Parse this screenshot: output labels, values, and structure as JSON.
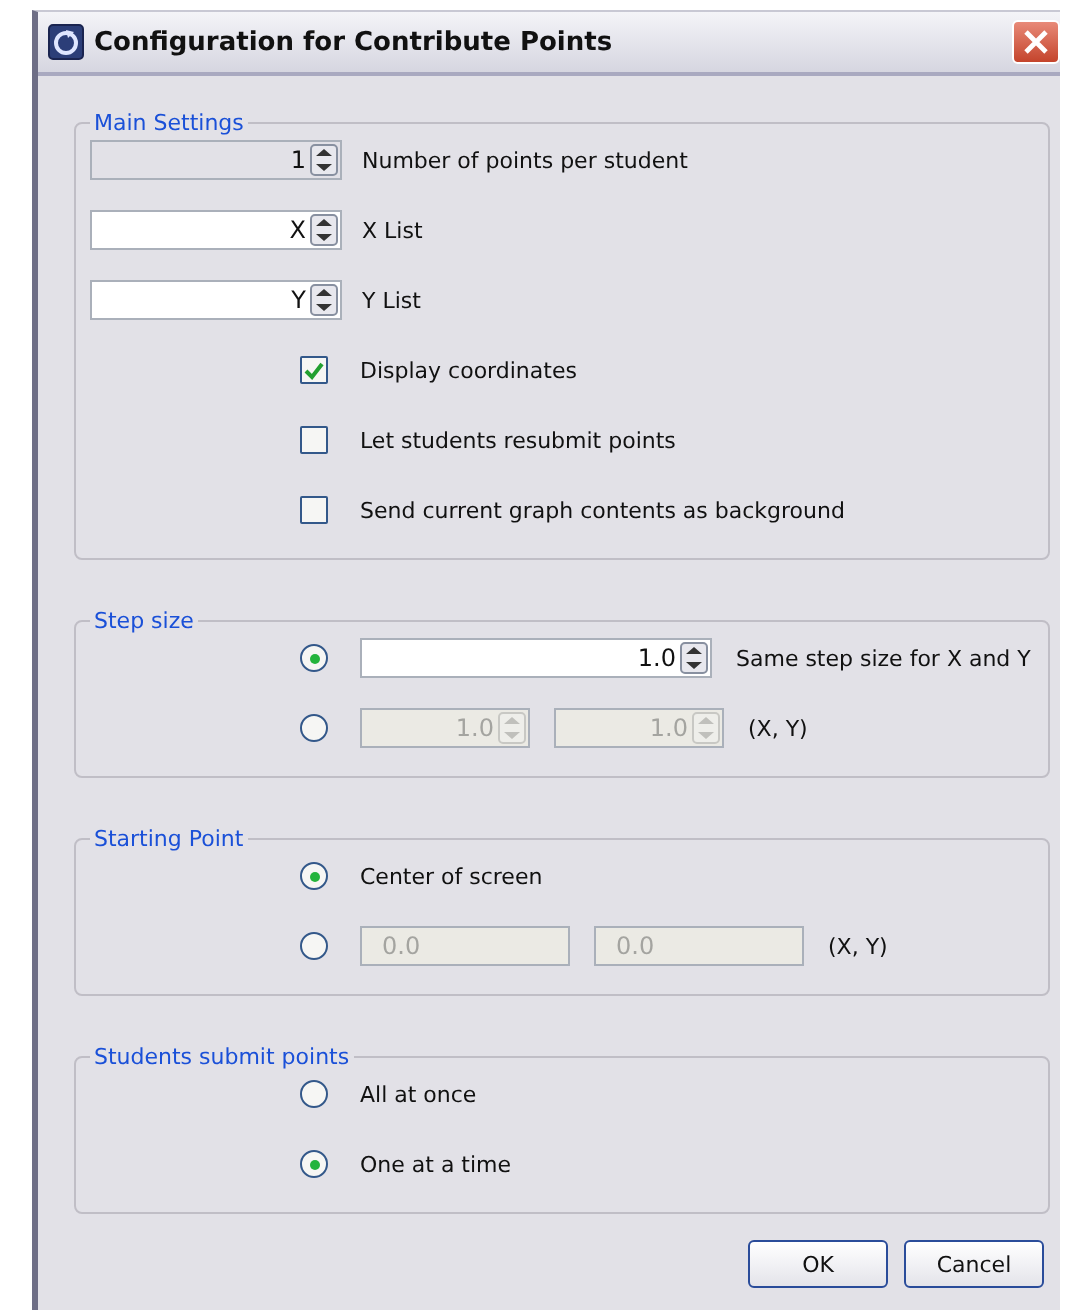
{
  "window": {
    "title": "Configuration for Contribute Points"
  },
  "sections": [
    {
      "title": "Main Settings",
      "rows": [
        {
          "kind": "spinner",
          "label": "Number of points per student",
          "field": {
            "value": "1",
            "editable": false,
            "disabled": false
          }
        },
        {
          "kind": "spinner",
          "label": "X List",
          "field": {
            "value": "X",
            "editable": true,
            "disabled": false
          }
        },
        {
          "kind": "spinner",
          "label": "Y List",
          "field": {
            "value": "Y",
            "editable": true,
            "disabled": false
          }
        },
        {
          "kind": "checkbox",
          "label": "Display coordinates",
          "checked": true
        },
        {
          "kind": "checkbox",
          "label": "Let students resubmit points",
          "checked": false
        },
        {
          "kind": "checkbox",
          "label": "Send current graph contents as background",
          "checked": false
        }
      ]
    },
    {
      "title": "Step size",
      "rows": [
        {
          "kind": "radio",
          "selected": true,
          "fields": [
            {
              "kind": "spinner",
              "value": "1.0",
              "disabled": false
            }
          ],
          "label": "Same step size for X and Y"
        },
        {
          "kind": "radio",
          "selected": false,
          "fields": [
            {
              "kind": "spinner",
              "value": "1.0",
              "disabled": true
            },
            {
              "kind": "spinner",
              "value": "1.0",
              "disabled": true
            }
          ],
          "label": "(X, Y)"
        }
      ]
    },
    {
      "title": "Starting Point",
      "rows": [
        {
          "kind": "radio",
          "selected": true,
          "fields": [],
          "label": "Center of screen"
        },
        {
          "kind": "radio",
          "selected": false,
          "fields": [
            {
              "kind": "text",
              "value": "0.0",
              "disabled": true
            },
            {
              "kind": "text",
              "value": "0.0",
              "disabled": true
            }
          ],
          "label": "(X, Y)"
        }
      ]
    },
    {
      "title": "Students submit points",
      "rows": [
        {
          "kind": "radio",
          "selected": false,
          "fields": [],
          "label": "All at once"
        },
        {
          "kind": "radio",
          "selected": true,
          "fields": [],
          "label": "One at a time"
        }
      ]
    }
  ],
  "buttons": [
    "OK",
    "Cancel"
  ]
}
